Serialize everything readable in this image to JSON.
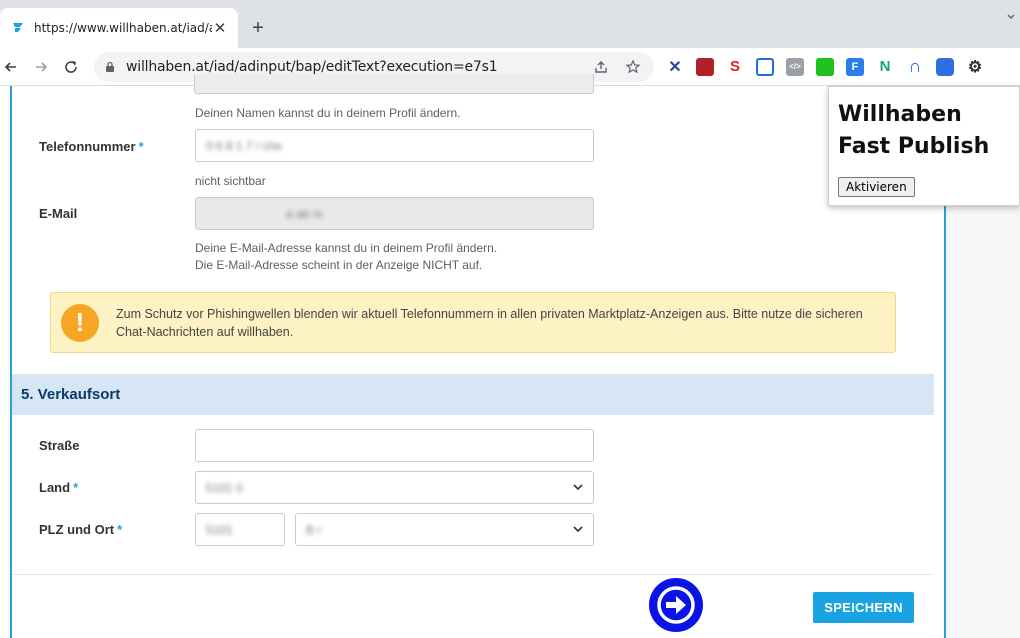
{
  "browser": {
    "tab_title": "https://www.willhaben.at/iad/adi",
    "tab_close": "✕",
    "new_tab": "+",
    "url": "willhaben.at/iad/adinput/bap/editText?execution=e7s1"
  },
  "form": {
    "name_hint": "Deinen Namen kannst du in deinem Profil ändern.",
    "phone_label": "Telefonnummer",
    "phone_value": "0 6 8 1 7 / che",
    "phone_hint": "nicht sichtbar",
    "email_label": "E-Mail",
    "email_value": "a        ab    m",
    "email_hint_1": "Deine E-Mail-Adresse kannst du in deinem Profil ändern.",
    "email_hint_2": "Die E-Mail-Adresse scheint in der Anzeige NICHT auf.",
    "required_marker": "*"
  },
  "notice": {
    "icon": "!",
    "text": "Zum Schutz vor Phishingwellen blenden wir aktuell Telefonnummern in allen privaten Marktplatz-Anzeigen aus. Bitte nutze die sicheren Chat-Nachrichten auf willhaben."
  },
  "location": {
    "section_title": "5. Verkaufsort",
    "street_label": "Straße",
    "country_label": "Land",
    "country_value": "5101 ö",
    "zip_label": "PLZ und Ort",
    "zip_value": "5101",
    "city_value": "B        r"
  },
  "actions": {
    "save_label": "SPEICHERN"
  },
  "popup": {
    "title": "Willhaben Fast Publish",
    "activate_label": "Aktivieren"
  },
  "colors": {
    "accent": "#2a9fd6",
    "section_bg": "#d6e6f5",
    "notice_bg": "#fdf2c3",
    "warn": "#f5a623",
    "arrow_button": "#0a14e6",
    "save_button": "#1aa3e3"
  }
}
